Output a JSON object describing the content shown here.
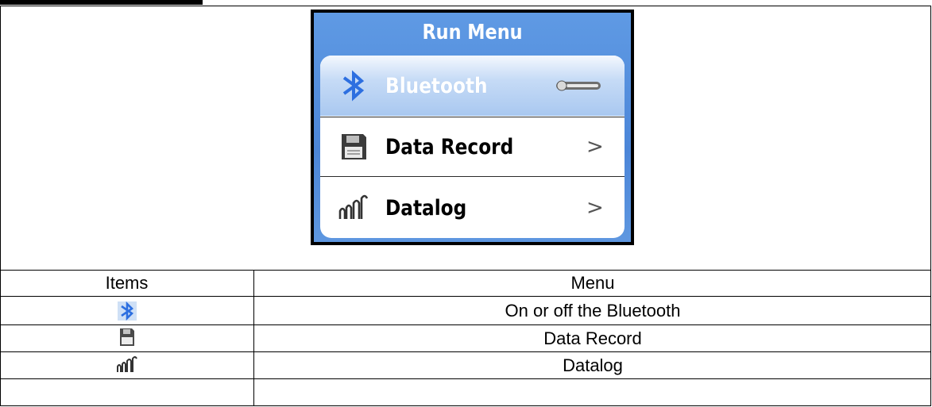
{
  "screen": {
    "title": "Run Menu",
    "items": [
      {
        "label": "Bluetooth",
        "icon": "bluetooth-icon",
        "control": "toggle-switch"
      },
      {
        "label": "Data Record",
        "icon": "floppy-disk-icon",
        "control": ">"
      },
      {
        "label": "Datalog",
        "icon": "datalog-bars-icon",
        "control": ">"
      }
    ]
  },
  "table": {
    "headers": [
      "Items",
      "Menu"
    ],
    "rows": [
      {
        "icon": "bluetooth-icon",
        "menu": "On or off the Bluetooth"
      },
      {
        "icon": "floppy-disk-icon",
        "menu": "Data Record"
      },
      {
        "icon": "datalog-bars-icon",
        "menu": "Datalog"
      }
    ]
  },
  "colors": {
    "screen_blue": "#4c86d8",
    "bluetooth_blue": "#2d6fe0",
    "highlight_row": "#c6dbf6"
  }
}
